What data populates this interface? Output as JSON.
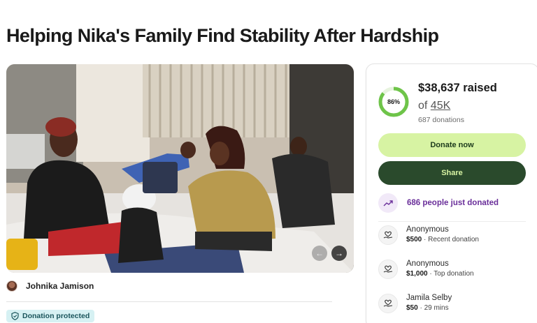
{
  "page": {
    "title": "Helping Nika's Family Find Stability After Hardship"
  },
  "hero": {
    "prev_icon": "←",
    "next_icon": "→"
  },
  "organizer": {
    "name": "Johnika Jamison"
  },
  "badge": {
    "label": "Donation protected",
    "icon": "shield-icon"
  },
  "card": {
    "percent": 86,
    "percent_label": "86%",
    "raised": "$38,637 raised",
    "goal_prefix": "of ",
    "goal_amount": "45K",
    "donations_count": "687 donations",
    "donate_label": "Donate now",
    "share_label": "Share",
    "trend_text": "686 people just donated",
    "colors": {
      "ring": "#6ec449",
      "ring_track": "#e7f3de",
      "donate_bg": "#d7f3a3",
      "share_bg": "#2a4a2c",
      "trend_text": "#6a2f9a",
      "badge_bg": "#d6f1f3"
    }
  },
  "donors": [
    {
      "name": "Anonymous",
      "amount": "$500",
      "note": " · Recent donation"
    },
    {
      "name": "Anonymous",
      "amount": "$1,000",
      "note": " · Top donation"
    },
    {
      "name": "Jamila Selby",
      "amount": "$50",
      "note": " · 29 mins"
    }
  ]
}
